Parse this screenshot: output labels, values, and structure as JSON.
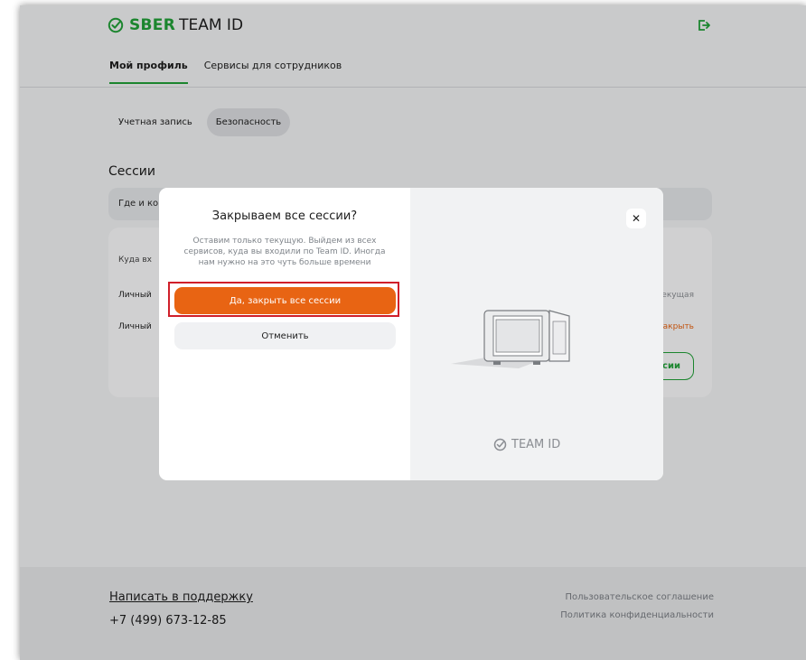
{
  "header": {
    "logo_brand": "SBER",
    "logo_product": "TEAM ID",
    "exit_icon": "logout-icon"
  },
  "nav": {
    "tabs": [
      "Мой профиль",
      "Сервисы для сотрудников"
    ],
    "active": "Мой профиль"
  },
  "subtabs": {
    "items": [
      "Учетная запись",
      "Безопасность"
    ],
    "active": "Безопасность"
  },
  "sessions": {
    "title": "Сессии",
    "where_label": "Где и ко",
    "card": {
      "caption": "Куда вх",
      "row1_left": "Личный",
      "row1_right": "екущая",
      "row2_left": "Личный",
      "row2_right": "акрыть",
      "button_tail": "сии"
    }
  },
  "modal": {
    "title": "Закрываем все сессии?",
    "text": "Оставим только текущую. Выйдем из всех сервисов, куда вы входили по Team ID. Иногда нам нужно на это чуть больше времени",
    "confirm_label": "Да, закрыть все сессии",
    "cancel_label": "Отменить",
    "close_glyph": "✕",
    "brand": "TEAM ID"
  },
  "footer": {
    "support_link": "Написать в поддержку",
    "phone": "+7 (499) 673-12-85",
    "links": [
      "Пользовательское соглашение",
      "Политика конфиденциальности"
    ]
  },
  "colors": {
    "brand_green": "#21a038",
    "accent_orange": "#e86413",
    "highlight_red": "#d01f2a"
  }
}
